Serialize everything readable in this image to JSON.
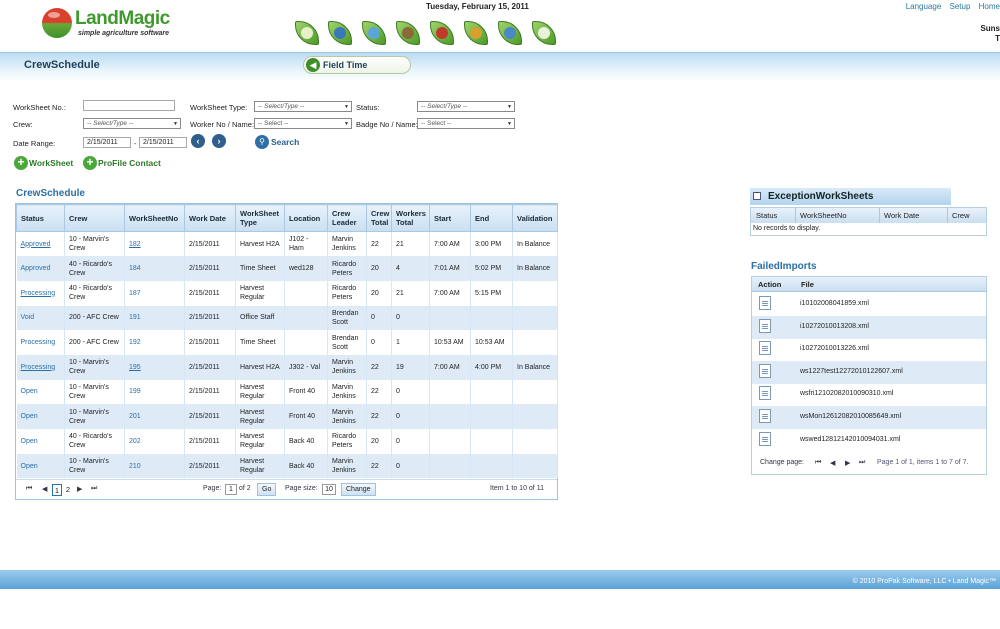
{
  "header": {
    "logo_name": "LandMagic",
    "logo_tagline": "simple agriculture software",
    "date": "Tuesday, February 15, 2011",
    "links": [
      "Language",
      "Setup",
      "Home"
    ],
    "user_line1": "Suns",
    "user_line2": "T",
    "nav_icons": [
      "blank-leaf-icon",
      "globe-icon",
      "people-icon",
      "barn-icon",
      "house-icon",
      "tractor-icon",
      "chart-icon",
      "leaf-icon"
    ]
  },
  "page": {
    "title": "CrewSchedule",
    "field_time": "Field Time"
  },
  "filters": {
    "worksheet_no_label": "WorkSheet No.:",
    "worksheet_no_value": "",
    "worksheet_type_label": "WorkSheet Type:",
    "worksheet_type_value": "-- Select/Type --",
    "status_label": "Status:",
    "status_value": "-- Select/Type --",
    "crew_label": "Crew:",
    "crew_value": "-- Select/Type --",
    "worker_label": "Worker No / Name:",
    "worker_value": "-- Select --",
    "badge_label": "Badge No / Name:",
    "badge_value": "-- Select --",
    "date_range_label": "Date Range:",
    "date_from": "2/15/2011",
    "date_sep": "-",
    "date_to": "2/15/2011",
    "search_label": "Search",
    "add_worksheet": "WorkSheet",
    "add_profile": "ProFile Contact"
  },
  "crew_schedule": {
    "title": "CrewSchedule",
    "columns": [
      "Status",
      "Crew",
      "WorkSheetNo",
      "Work Date",
      "WorkSheet Type",
      "Location",
      "Crew Leader",
      "Crew Total",
      "Workers Total",
      "Start",
      "End",
      "Validation"
    ],
    "rows": [
      {
        "status": "Approved",
        "status_link": true,
        "crew": "10 - Marvin's Crew",
        "ws": "182",
        "ws_link": true,
        "date": "2/15/2011",
        "type": "Harvest H2A",
        "loc": "J102 - Ham",
        "leader": "Marvin Jenkins",
        "crew_total": "22",
        "workers": "21",
        "start": "7:00 AM",
        "end": "3:00 PM",
        "valid": "In Balance"
      },
      {
        "status": "Approved",
        "status_link": false,
        "crew": "40 - Ricardo's Crew",
        "ws": "184",
        "ws_link": false,
        "date": "2/15/2011",
        "type": "Time Sheet",
        "loc": "wed128",
        "leader": "Ricardo Peters",
        "crew_total": "20",
        "workers": "4",
        "start": "7:01 AM",
        "end": "5:02 PM",
        "valid": "In Balance"
      },
      {
        "status": "Processing",
        "status_link": true,
        "crew": "40 - Ricardo's Crew",
        "ws": "187",
        "ws_link": false,
        "date": "2/15/2011",
        "type": "Harvest Regular",
        "loc": "",
        "leader": "Ricardo Peters",
        "crew_total": "20",
        "workers": "21",
        "start": "7:00 AM",
        "end": "5:15 PM",
        "valid": ""
      },
      {
        "status": "Void",
        "status_link": false,
        "crew": "200 - AFC Crew",
        "ws": "191",
        "ws_link": false,
        "date": "2/15/2011",
        "type": "Office Staff",
        "loc": "",
        "leader": "Brendan Scott",
        "crew_total": "0",
        "workers": "0",
        "start": "",
        "end": "",
        "valid": ""
      },
      {
        "status": "Processing",
        "status_link": false,
        "crew": "200 - AFC Crew",
        "ws": "192",
        "ws_link": false,
        "date": "2/15/2011",
        "type": "Time Sheet",
        "loc": "",
        "leader": "Brendan Scott",
        "crew_total": "0",
        "workers": "1",
        "start": "10:53 AM",
        "end": "10:53 AM",
        "valid": ""
      },
      {
        "status": "Processing",
        "status_link": true,
        "crew": "10 - Marvin's Crew",
        "ws": "195",
        "ws_link": true,
        "date": "2/15/2011",
        "type": "Harvest H2A",
        "loc": "J302 - Val",
        "leader": "Marvin Jenkins",
        "crew_total": "22",
        "workers": "19",
        "start": "7:00 AM",
        "end": "4:00 PM",
        "valid": "In Balance"
      },
      {
        "status": "Open",
        "status_link": false,
        "crew": "10 - Marvin's Crew",
        "ws": "199",
        "ws_link": false,
        "date": "2/15/2011",
        "type": "Harvest Regular",
        "loc": "Front 40",
        "leader": "Marvin Jenkins",
        "crew_total": "22",
        "workers": "0",
        "start": "",
        "end": "",
        "valid": ""
      },
      {
        "status": "Open",
        "status_link": false,
        "crew": "10 - Marvin's Crew",
        "ws": "201",
        "ws_link": false,
        "date": "2/15/2011",
        "type": "Harvest Regular",
        "loc": "Front 40",
        "leader": "Marvin Jenkins",
        "crew_total": "22",
        "workers": "0",
        "start": "",
        "end": "",
        "valid": ""
      },
      {
        "status": "Open",
        "status_link": false,
        "crew": "40 - Ricardo's Crew",
        "ws": "202",
        "ws_link": false,
        "date": "2/15/2011",
        "type": "Harvest Regular",
        "loc": "Back 40",
        "leader": "Ricardo Peters",
        "crew_total": "20",
        "workers": "0",
        "start": "",
        "end": "",
        "valid": ""
      },
      {
        "status": "Open",
        "status_link": false,
        "crew": "10 - Marvin's Crew",
        "ws": "210",
        "ws_link": false,
        "date": "2/15/2011",
        "type": "Harvest Regular",
        "loc": "Back 40",
        "leader": "Marvin Jenkins",
        "crew_total": "22",
        "workers": "0",
        "start": "",
        "end": "",
        "valid": ""
      }
    ],
    "pager": {
      "pages": [
        "1",
        "2"
      ],
      "current_page": "1",
      "page_label": "Page:",
      "page_value": "1",
      "of_label": "of 2",
      "go": "Go",
      "size_label": "Page size:",
      "size_value": "10",
      "change": "Change",
      "summary": "Item 1 to 10 of 11"
    }
  },
  "exceptions": {
    "title": "ExceptionWorkSheets",
    "columns": [
      "Status",
      "WorkSheetNo",
      "Work Date",
      "Crew"
    ],
    "empty": "No records to display."
  },
  "failed_imports": {
    "title": "FailedImports",
    "columns": [
      "Action",
      "File"
    ],
    "files": [
      "i10102008041859.xml",
      "i10272010013208.xml",
      "i10272010013226.xml",
      "ws1227test12272010122607.xml",
      "wsfri12102082010090310.xml",
      "wsMon12612082010085649.xml",
      "wswed12812142010094031.xml"
    ],
    "pager_label": "Change page:",
    "pager_summary": "Page 1 of 1, items 1 to 7 of 7."
  },
  "footer": {
    "text": "© 2010 ProPak Software, LLC • Land Magic™"
  }
}
